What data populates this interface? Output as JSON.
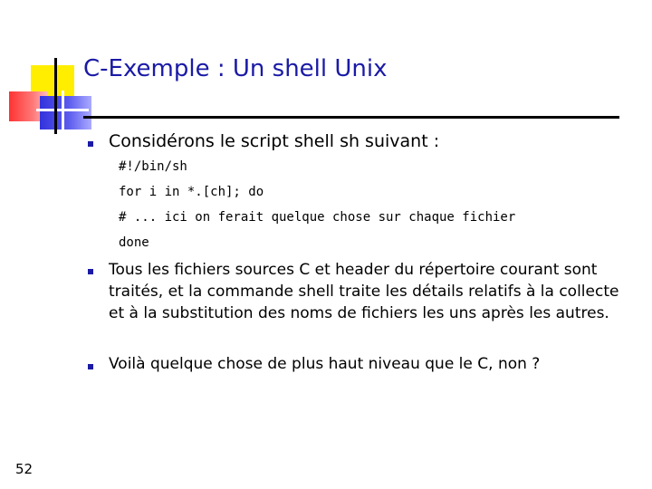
{
  "slide": {
    "title": "C-Exemple : Un shell Unix",
    "page_number": "52"
  },
  "bullets": [
    {
      "text": "Considérons le script shell sh suivant :"
    },
    {
      "text": "Tous les fichiers sources C et header du répertoire courant sont traités, et la commande shell traite les détails relatifs à la collecte et à la substitution des noms de fichiers les uns après les autres."
    },
    {
      "text": "Voilà quelque chose de plus haut niveau que le C, non ?"
    }
  ],
  "code_lines": [
    "#!/bin/sh",
    "for i in *.[ch]; do",
    "# ... ici on ferait quelque chose sur chaque fichier",
    "done"
  ],
  "colors": {
    "title": "#1a1aa6",
    "bullet": "#1a1aa6",
    "deco_yellow": "#ffee00",
    "deco_red": "#ff3333",
    "deco_blue": "#3333dd"
  }
}
